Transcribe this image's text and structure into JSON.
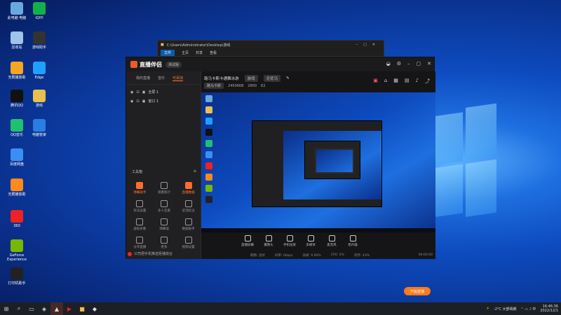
{
  "desktop_icons": [
    {
      "label": "此电脑\n电脑",
      "color": "#6aa9e0"
    },
    {
      "label": "iQIYI",
      "color": "#12b04a"
    },
    {
      "label": "回收站",
      "color": "#9fc4e8"
    },
    {
      "label": "游戏助手",
      "color": "#333"
    },
    {
      "label": "无限播放助",
      "color": "#f5a623"
    },
    {
      "label": "Edge",
      "color": "#1ea0ff"
    },
    {
      "label": "腾讯QQ",
      "color": "#111"
    },
    {
      "label": "游戏",
      "color": "#e8c050"
    },
    {
      "label": "QQ音乐",
      "color": "#20c070"
    },
    {
      "label": "电脑管家",
      "color": "#2a7de1"
    },
    {
      "label": "百度网盘",
      "color": "#3a8ef5"
    },
    {
      "label": "无限播放助",
      "color": "#ff8a1a"
    },
    {
      "label": "360",
      "color": "#e22"
    },
    {
      "label": "GeForce Experience",
      "color": "#76b900"
    },
    {
      "label": "打印机助手",
      "color": "#222"
    }
  ],
  "explorer": {
    "path": "C:\\Users\\Administrator\\Desktop\\游戏",
    "tabs": [
      "文件",
      "主页",
      "共享",
      "查看"
    ]
  },
  "app": {
    "brand": "直播伴侣",
    "version": "测试版",
    "tabs": [
      "我的直播",
      "音乐",
      "可添加"
    ],
    "scenes": [
      "全屏 1",
      "窗口 1"
    ],
    "tools_title": "工具箱",
    "tools": [
      "弹幕助手",
      "观看统计",
      "直播数据",
      "玩法设置",
      "多人连麦",
      "说话标注",
      "虚拟形象",
      "弹幕墙",
      "数据助手",
      "分享直播",
      "更多",
      "视频设置"
    ],
    "hint": "公司把手机推送拒播放台",
    "room_title": "路马卡斯卡通舞冰游",
    "room_tag": "游戏",
    "room_sub": "无忧马",
    "room_tag2": "路马卡斯",
    "stats": {
      "fans": "2450668",
      "likes": "2800",
      "online": "62"
    },
    "bottom": [
      "直播屏幕",
      "摄像头",
      "手机投屏",
      "多媒体",
      "麦克风",
      "扬声器"
    ],
    "live_btn": "开始直播",
    "status": [
      "网络: 良好",
      "码率: 0kbps",
      "丢帧: 0.00%",
      "CPU: 5%",
      "内存: 43%"
    ],
    "timer": "00:00:00"
  },
  "taskbar": {
    "weather": "-2°C 大部晴朗",
    "time": "16:46:36",
    "date": "2022/12/1"
  }
}
